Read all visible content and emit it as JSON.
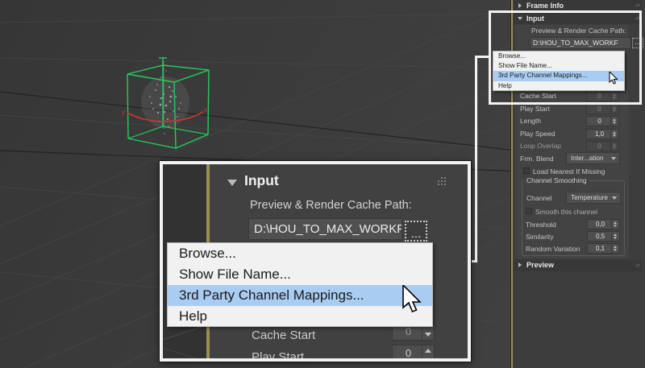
{
  "viewport": {
    "x_axis_label": "x",
    "y_axis_label": "y"
  },
  "panel": {
    "frame_info_title": "Frame Info",
    "input_title": "Input",
    "preview_title": "Preview",
    "input": {
      "path_label": "Preview & Render Cache Path:",
      "path_value": "D:\\HOU_TO_MAX_WORKF",
      "browse_ellipsis": "...",
      "cache_start": {
        "label": "Cache Start",
        "value": "0"
      },
      "play_start": {
        "label": "Play Start",
        "value": "0"
      },
      "length": {
        "label": "Length",
        "value": "0"
      },
      "play_speed": {
        "label": "Play Speed",
        "value": "1,0"
      },
      "loop_overlap": {
        "label": "Loop Overlap",
        "value": "0"
      },
      "frm_blend": {
        "label": "Frm. Blend",
        "value": "Inter...ation"
      },
      "load_nearest_label": "Load Nearest If Missing",
      "channel_smoothing": {
        "title": "Channel Smoothing",
        "channel": {
          "label": "Channel",
          "value": "Temperature"
        },
        "smooth_label": "Smooth this channel",
        "threshold": {
          "label": "Threshold",
          "value": "0,0"
        },
        "similarity": {
          "label": "Similarity",
          "value": "0,5"
        },
        "random_variation": {
          "label": "Random Variation",
          "value": "0,1"
        }
      }
    }
  },
  "context_menu": {
    "browse": "Browse...",
    "show_file_name": "Show File Name...",
    "third_party": "3rd Party Channel Mappings...",
    "help": "Help"
  },
  "colors": {
    "menu_highlight": "#a9cdf2",
    "callout_border": "#f3f3f3",
    "splitter": "#9b8e52",
    "wireframe_green": "#21cd5a",
    "axis_red": "#c23a32"
  }
}
